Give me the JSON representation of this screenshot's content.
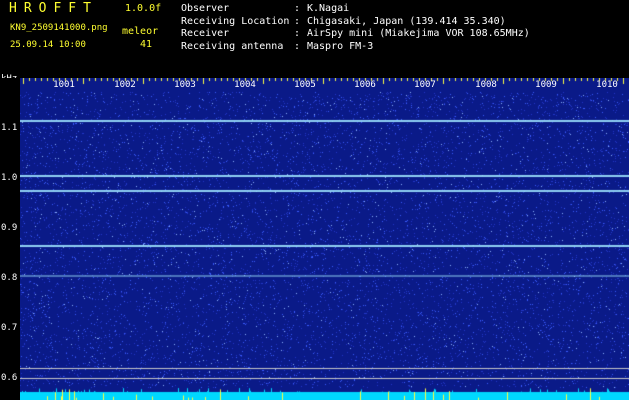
{
  "app": {
    "logo": "HROFFT",
    "version": "1.0.0f"
  },
  "file": {
    "name": "KN9_2509141000.png",
    "datetime": "25.09.14 10:00"
  },
  "display": {
    "y_mode": "meleor",
    "frame_count": "41"
  },
  "station": {
    "fields": [
      {
        "key": "Observer",
        "value": "K.Nagai"
      },
      {
        "key": "Receiving Location",
        "value": "Chigasaki, Japan (139.414 35.340)"
      },
      {
        "key": "Receiver",
        "value": "AirSpy mini (Miakejima VOR 108.65MHz)"
      },
      {
        "key": "Receiving antenna",
        "value": "Maspro FM-3"
      }
    ]
  },
  "axes": {
    "y_unit": "kHz",
    "y_ticks": [
      "1.1",
      "1.0",
      "0.9",
      "0.8",
      "0.7",
      "0.6"
    ],
    "x_ticks": [
      "1001",
      "1002",
      "1003",
      "1004",
      "1005",
      "1006",
      "1007",
      "1008",
      "1009",
      "1010"
    ]
  },
  "spectrogram": {
    "background_color": "#0a1a88",
    "noise_color": "#3a5cff",
    "signal_color": "#9fe6ff",
    "signal_frequencies_khz": [
      1.12,
      1.01,
      0.98,
      0.87,
      0.81
    ],
    "reference_frequencies_khz": [
      0.62,
      0.6
    ],
    "bottom_strip_color": "#00d8ff"
  }
}
